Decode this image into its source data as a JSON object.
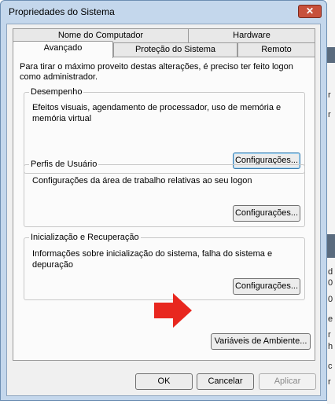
{
  "window": {
    "title": "Propriedades do Sistema",
    "close_label": "✕"
  },
  "tabs": {
    "row1": [
      "Nome do Computador",
      "Hardware"
    ],
    "row2": [
      "Avançado",
      "Proteção do Sistema",
      "Remoto"
    ],
    "active": "Avançado"
  },
  "intro_text": "Para tirar o máximo proveito destas alterações, é preciso ter feito logon como administrador.",
  "groups": {
    "performance": {
      "title": "Desempenho",
      "description": "Efeitos visuais, agendamento de processador, uso de memória e memória virtual",
      "button": "Configurações..."
    },
    "profiles": {
      "title": "Perfis de Usuário",
      "description": "Configurações da área de trabalho relativas ao seu logon",
      "button": "Configurações..."
    },
    "startup": {
      "title": "Inicialização e Recuperação",
      "description": "Informações sobre inicialização do sistema, falha do sistema e depuração",
      "button": "Configurações..."
    }
  },
  "env_button": "Variáveis de Ambiente...",
  "footer": {
    "ok": "OK",
    "cancel": "Cancelar",
    "apply": "Aplicar"
  },
  "background_fragments": [
    "r",
    "r",
    "d",
    "0",
    "0",
    "e",
    "r",
    "h",
    "c",
    "r"
  ],
  "colors": {
    "arrow": "#e8271f",
    "close_button": "#c7503b",
    "frame": "#c4d7ec"
  }
}
